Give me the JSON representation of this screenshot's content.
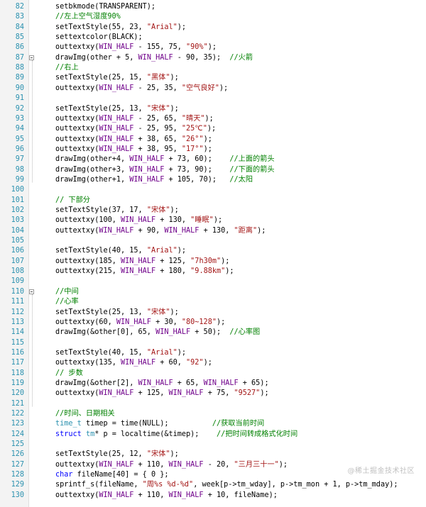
{
  "editor": {
    "lines": [
      {
        "n": "82",
        "t": [
          [
            "setbkmode(TRANSPARENT);",
            "plain"
          ]
        ]
      },
      {
        "n": "83",
        "t": [
          [
            "//左上空气湿度90%",
            "cmt"
          ]
        ]
      },
      {
        "n": "84",
        "t": [
          [
            "setTextStyle",
            "fn"
          ],
          [
            "(55, 23, ",
            "plain"
          ],
          [
            "\"Arial\"",
            "str"
          ],
          [
            ");",
            "plain"
          ]
        ]
      },
      {
        "n": "85",
        "t": [
          [
            "settextcolor(BLACK);",
            "plain"
          ]
        ]
      },
      {
        "n": "86",
        "t": [
          [
            "outtextxy(",
            "plain"
          ],
          [
            "WIN_HALF",
            "macro"
          ],
          [
            " - 155, 75, ",
            "plain"
          ],
          [
            "\"90%\"",
            "str"
          ],
          [
            ");",
            "plain"
          ]
        ]
      },
      {
        "n": "87",
        "t": [
          [
            "drawImg(other + 5, ",
            "plain"
          ],
          [
            "WIN_HALF",
            "macro"
          ],
          [
            " - 90, 35);  ",
            "plain"
          ],
          [
            "//火箭",
            "cmt"
          ]
        ]
      },
      {
        "n": "88",
        "t": [
          [
            "//右上",
            "cmt"
          ]
        ]
      },
      {
        "n": "89",
        "t": [
          [
            "setTextStyle",
            "fn"
          ],
          [
            "(25, 15, ",
            "plain"
          ],
          [
            "\"黑体\"",
            "str"
          ],
          [
            ");",
            "plain"
          ]
        ]
      },
      {
        "n": "90",
        "t": [
          [
            "outtextxy(",
            "plain"
          ],
          [
            "WIN_HALF",
            "macro"
          ],
          [
            " - 25, 35, ",
            "plain"
          ],
          [
            "\"空气良好\"",
            "str"
          ],
          [
            ");",
            "plain"
          ]
        ]
      },
      {
        "n": "91",
        "t": []
      },
      {
        "n": "92",
        "t": [
          [
            "setTextStyle",
            "fn"
          ],
          [
            "(25, 13, ",
            "plain"
          ],
          [
            "\"宋体\"",
            "str"
          ],
          [
            ");",
            "plain"
          ]
        ]
      },
      {
        "n": "93",
        "t": [
          [
            "outtextxy(",
            "plain"
          ],
          [
            "WIN_HALF",
            "macro"
          ],
          [
            " - 25, 65, ",
            "plain"
          ],
          [
            "\"晴天\"",
            "str"
          ],
          [
            ");",
            "plain"
          ]
        ]
      },
      {
        "n": "94",
        "t": [
          [
            "outtextxy(",
            "plain"
          ],
          [
            "WIN_HALF",
            "macro"
          ],
          [
            " - 25, 95, ",
            "plain"
          ],
          [
            "\"25℃\"",
            "str"
          ],
          [
            ");",
            "plain"
          ]
        ]
      },
      {
        "n": "95",
        "t": [
          [
            "outtextxy(",
            "plain"
          ],
          [
            "WIN_HALF",
            "macro"
          ],
          [
            " + 38, 65, ",
            "plain"
          ],
          [
            "\"26°\"",
            "str"
          ],
          [
            ");",
            "plain"
          ]
        ]
      },
      {
        "n": "96",
        "t": [
          [
            "outtextxy(",
            "plain"
          ],
          [
            "WIN_HALF",
            "macro"
          ],
          [
            " + 38, 95, ",
            "plain"
          ],
          [
            "\"17°\"",
            "str"
          ],
          [
            ");",
            "plain"
          ]
        ]
      },
      {
        "n": "97",
        "t": [
          [
            "drawImg(other+4, ",
            "plain"
          ],
          [
            "WIN_HALF",
            "macro"
          ],
          [
            " + 73, 60);    ",
            "plain"
          ],
          [
            "//上面的箭头",
            "cmt"
          ]
        ]
      },
      {
        "n": "98",
        "t": [
          [
            "drawImg(other+3, ",
            "plain"
          ],
          [
            "WIN_HALF",
            "macro"
          ],
          [
            " + 73, 90);    ",
            "plain"
          ],
          [
            "//下面的箭头",
            "cmt"
          ]
        ]
      },
      {
        "n": "99",
        "t": [
          [
            "drawImg(other+1, ",
            "plain"
          ],
          [
            "WIN_HALF",
            "macro"
          ],
          [
            " + 105, 70);   ",
            "plain"
          ],
          [
            "//太阳",
            "cmt"
          ]
        ]
      },
      {
        "n": "100",
        "t": []
      },
      {
        "n": "101",
        "t": [
          [
            "// 下部分",
            "cmt"
          ]
        ]
      },
      {
        "n": "102",
        "t": [
          [
            "setTextStyle",
            "fn"
          ],
          [
            "(37, 17, ",
            "plain"
          ],
          [
            "\"宋体\"",
            "str"
          ],
          [
            ");",
            "plain"
          ]
        ]
      },
      {
        "n": "103",
        "t": [
          [
            "outtextxy(100, ",
            "plain"
          ],
          [
            "WIN_HALF",
            "macro"
          ],
          [
            " + 130, ",
            "plain"
          ],
          [
            "\"睡眠\"",
            "str"
          ],
          [
            ");",
            "plain"
          ]
        ]
      },
      {
        "n": "104",
        "t": [
          [
            "outtextxy(",
            "plain"
          ],
          [
            "WIN_HALF",
            "macro"
          ],
          [
            " + 90, ",
            "plain"
          ],
          [
            "WIN_HALF",
            "macro"
          ],
          [
            " + 130, ",
            "plain"
          ],
          [
            "\"距离\"",
            "str"
          ],
          [
            ");",
            "plain"
          ]
        ]
      },
      {
        "n": "105",
        "t": []
      },
      {
        "n": "106",
        "t": [
          [
            "setTextStyle",
            "fn"
          ],
          [
            "(40, 15, ",
            "plain"
          ],
          [
            "\"Arial\"",
            "str"
          ],
          [
            ");",
            "plain"
          ]
        ]
      },
      {
        "n": "107",
        "t": [
          [
            "outtextxy(185, ",
            "plain"
          ],
          [
            "WIN_HALF",
            "macro"
          ],
          [
            " + 125, ",
            "plain"
          ],
          [
            "\"7h30m\"",
            "str"
          ],
          [
            ");",
            "plain"
          ]
        ]
      },
      {
        "n": "108",
        "t": [
          [
            "outtextxy(215, ",
            "plain"
          ],
          [
            "WIN_HALF",
            "macro"
          ],
          [
            " + 180, ",
            "plain"
          ],
          [
            "\"9.88km\"",
            "str"
          ],
          [
            ");",
            "plain"
          ]
        ]
      },
      {
        "n": "109",
        "t": []
      },
      {
        "n": "110",
        "t": [
          [
            "//中间",
            "cmt"
          ]
        ]
      },
      {
        "n": "111",
        "t": [
          [
            "//心率",
            "cmt"
          ]
        ]
      },
      {
        "n": "112",
        "t": [
          [
            "setTextStyle",
            "fn"
          ],
          [
            "(25, 13, ",
            "plain"
          ],
          [
            "\"宋体\"",
            "str"
          ],
          [
            ");",
            "plain"
          ]
        ]
      },
      {
        "n": "113",
        "t": [
          [
            "outtextxy(60, ",
            "plain"
          ],
          [
            "WIN_HALF",
            "macro"
          ],
          [
            " + 30, ",
            "plain"
          ],
          [
            "\"80~128\"",
            "str"
          ],
          [
            ");",
            "plain"
          ]
        ]
      },
      {
        "n": "114",
        "t": [
          [
            "drawImg(&other[0], 65, ",
            "plain"
          ],
          [
            "WIN_HALF",
            "macro"
          ],
          [
            " + 50);  ",
            "plain"
          ],
          [
            "//心率图",
            "cmt"
          ]
        ]
      },
      {
        "n": "115",
        "t": []
      },
      {
        "n": "116",
        "t": [
          [
            "setTextStyle",
            "fn"
          ],
          [
            "(40, 15, ",
            "plain"
          ],
          [
            "\"Arial\"",
            "str"
          ],
          [
            ");",
            "plain"
          ]
        ]
      },
      {
        "n": "117",
        "t": [
          [
            "outtextxy(135, ",
            "plain"
          ],
          [
            "WIN_HALF",
            "macro"
          ],
          [
            " + 60, ",
            "plain"
          ],
          [
            "\"92\"",
            "str"
          ],
          [
            ");",
            "plain"
          ]
        ]
      },
      {
        "n": "118",
        "t": [
          [
            "// 步数",
            "cmt"
          ]
        ]
      },
      {
        "n": "119",
        "t": [
          [
            "drawImg(&other[2], ",
            "plain"
          ],
          [
            "WIN_HALF",
            "macro"
          ],
          [
            " + 65, ",
            "plain"
          ],
          [
            "WIN_HALF",
            "macro"
          ],
          [
            " + 65);",
            "plain"
          ]
        ]
      },
      {
        "n": "120",
        "t": [
          [
            "outtextxy(",
            "plain"
          ],
          [
            "WIN_HALF",
            "macro"
          ],
          [
            " + 125, ",
            "plain"
          ],
          [
            "WIN_HALF",
            "macro"
          ],
          [
            " + 75, ",
            "plain"
          ],
          [
            "\"9527\"",
            "str"
          ],
          [
            ");",
            "plain"
          ]
        ]
      },
      {
        "n": "121",
        "t": []
      },
      {
        "n": "122",
        "t": [
          [
            "//时间、日期相关",
            "cmt"
          ]
        ]
      },
      {
        "n": "123",
        "t": [
          [
            "time_t",
            "type"
          ],
          [
            " timep = time(NULL);          ",
            "plain"
          ],
          [
            "//获取当前时间",
            "cmt"
          ]
        ]
      },
      {
        "n": "124",
        "t": [
          [
            "struct",
            "kw"
          ],
          [
            " ",
            "plain"
          ],
          [
            "tm",
            "type"
          ],
          [
            "* p = localtime(&timep);    ",
            "plain"
          ],
          [
            "//把时间转成格式化时间",
            "cmt"
          ]
        ]
      },
      {
        "n": "125",
        "t": []
      },
      {
        "n": "126",
        "t": [
          [
            "setTextStyle",
            "fn"
          ],
          [
            "(25, 12, ",
            "plain"
          ],
          [
            "\"宋体\"",
            "str"
          ],
          [
            ");",
            "plain"
          ]
        ]
      },
      {
        "n": "127",
        "t": [
          [
            "outtextxy(",
            "plain"
          ],
          [
            "WIN_HALF",
            "macro"
          ],
          [
            " + 110, ",
            "plain"
          ],
          [
            "WIN_HALF",
            "macro"
          ],
          [
            " - 20, ",
            "plain"
          ],
          [
            "\"三月三十一\"",
            "str"
          ],
          [
            ");",
            "plain"
          ]
        ]
      },
      {
        "n": "128",
        "t": [
          [
            "char",
            "kw"
          ],
          [
            " fileName[40] = { 0 };",
            "plain"
          ]
        ]
      },
      {
        "n": "129",
        "t": [
          [
            "sprintf_s(fileName, ",
            "plain"
          ],
          [
            "\"周%s %d-%d\"",
            "str"
          ],
          [
            ", week[p->tm_wday], p->tm_mon + 1, p->tm_mday);",
            "plain"
          ]
        ]
      },
      {
        "n": "130",
        "t": [
          [
            "outtextxy(",
            "plain"
          ],
          [
            "WIN_HALF",
            "macro"
          ],
          [
            " + 110, ",
            "plain"
          ],
          [
            "WIN_HALF",
            "macro"
          ],
          [
            " + 10, fileName);",
            "plain"
          ]
        ]
      }
    ]
  },
  "watermark": "@稀土掘金技术社区",
  "colors": {
    "line_number": "#2b91af",
    "comment": "#008000",
    "string": "#a31515",
    "macro": "#6f008a",
    "keyword": "#0000ff",
    "type": "#2b91af"
  }
}
